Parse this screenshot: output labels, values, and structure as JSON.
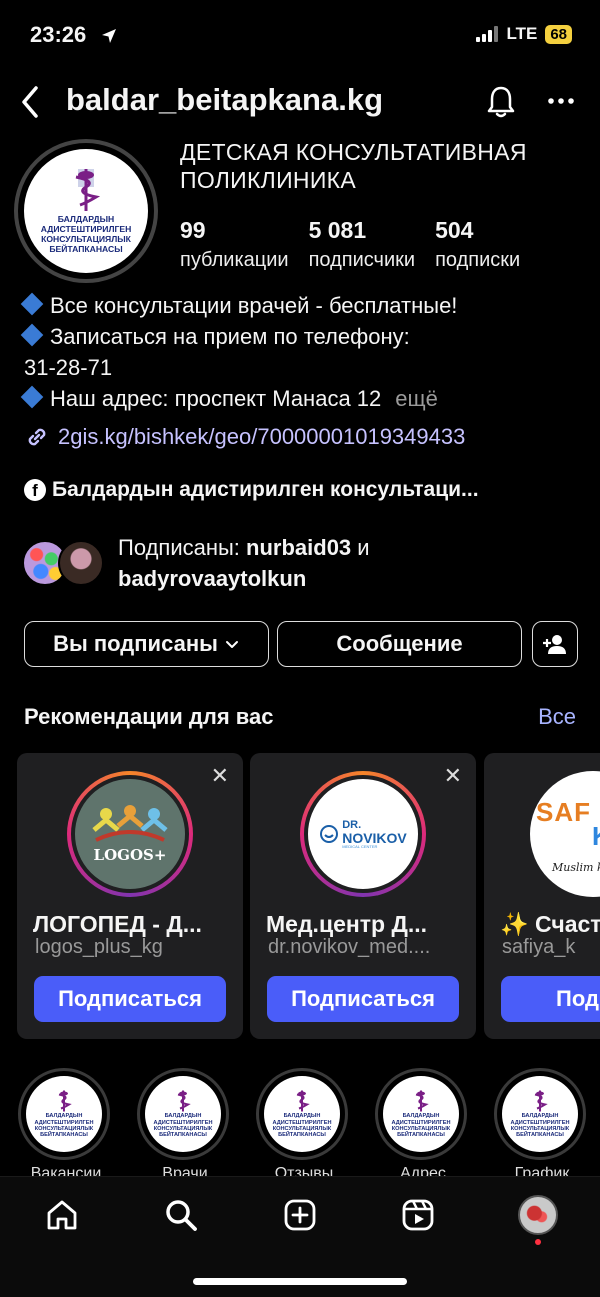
{
  "status_bar": {
    "time": "23:26",
    "network": "LTE",
    "battery": "68"
  },
  "header": {
    "username": "baldar_beitapkana.kg"
  },
  "profile": {
    "avatar_text": "БАЛДАРДЫН АДИСТЕШТИРИЛГЕН КОНСУЛЬТАЦИЯЛЫК БЕЙТАПКАНАСЫ",
    "avatar_lines": [
      "БАЛДАРДЫН",
      "АДИСТЕШТИРИЛГЕН",
      "КОНСУЛЬТАЦИЯЛЫК",
      "БЕЙТАПКАНАСЫ"
    ],
    "name_line1": "ДЕТСКАЯ  КОНСУЛЬТАТИВНАЯ",
    "name_line2": "ПОЛИКЛИНИКА",
    "stats": [
      {
        "value": "99",
        "label": "публикации"
      },
      {
        "value": "5 081",
        "label": "подписчики"
      },
      {
        "value": "504",
        "label": "подписки"
      }
    ],
    "bio_line1": "Все консультации врачей - бесплатные!",
    "bio_line2": "Записаться на прием по телефону:",
    "bio_line3": "31-28-71",
    "bio_line4": "Наш адрес: проспект Манаса 12",
    "bio_more": "ещё",
    "link": "2gis.kg/bishkek/geo/70000001019349433",
    "facebook": "Балдардын адистирилген консультаци...",
    "followed_prefix": "Подписаны: ",
    "followed_user1": "nurbaid03",
    "followed_and": " и",
    "followed_user2": "badyrovaaytolkun"
  },
  "actions": {
    "subscribed": "Вы подписаны",
    "message": "Сообщение"
  },
  "recommendations": {
    "title": "Рекомендации для вас",
    "all": "Все",
    "follow_label": "Подписаться",
    "cards": [
      {
        "name": "ЛОГОПЕД - Д...",
        "handle": "logos_plus_kg",
        "logo": "LOGOS+"
      },
      {
        "name": "Мед.центр Д...",
        "handle": "dr.novikov_med....",
        "logo_dr": "DR.",
        "logo_name": "NOVIKOV",
        "logo_sub": "MEDICAL CENTER"
      },
      {
        "name": "✨ Счаст",
        "handle": "safiya_k",
        "logo": "SAF",
        "logo2": "KI",
        "logo_script": "Muslim kin",
        "follow": "Подпис"
      }
    ]
  },
  "highlights": [
    {
      "label": "Вакансии"
    },
    {
      "label": "Врачи"
    },
    {
      "label": "Отзывы"
    },
    {
      "label": "Адрес"
    },
    {
      "label": "График"
    }
  ],
  "colors": {
    "accent": "#4a5df9",
    "link": "#c6c2ff",
    "background": "#000000"
  }
}
